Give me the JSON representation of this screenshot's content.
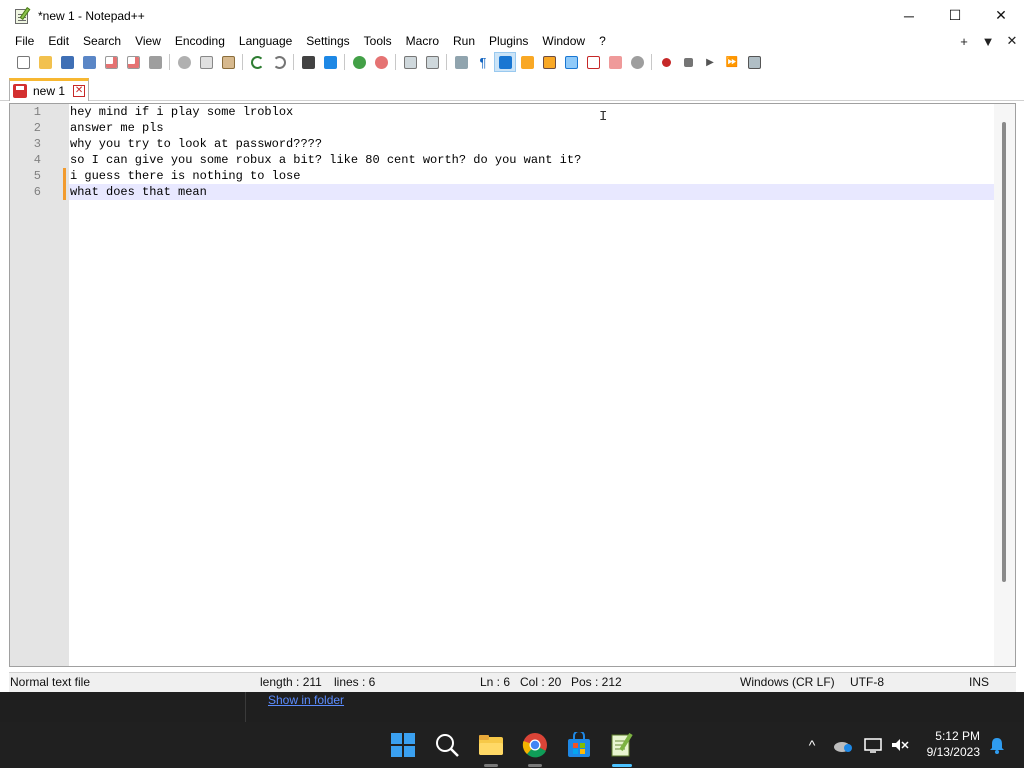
{
  "window": {
    "title": "*new 1 - Notepad++",
    "controls": {
      "minimize": "─",
      "maximize": "☐",
      "close": "✕"
    }
  },
  "menubar": {
    "items": [
      "File",
      "Edit",
      "Search",
      "View",
      "Encoding",
      "Language",
      "Settings",
      "Tools",
      "Macro",
      "Run",
      "Plugins",
      "Window",
      "?"
    ],
    "right": {
      "add": "+",
      "dropdown": "▼",
      "close": "✕"
    }
  },
  "tabs": [
    {
      "label": "new 1",
      "close": "✕"
    }
  ],
  "editor": {
    "line_numbers": [
      "1",
      "2",
      "3",
      "4",
      "5",
      "6"
    ],
    "lines": [
      "hey mind if i play some lroblox",
      "answer me pls",
      "why you try to look at password????",
      "so I can give you some robux a bit? like 80 cent worth? do you want it?",
      "i guess there is nothing to lose",
      "what does that mean"
    ],
    "current_line_index": 5
  },
  "statusbar": {
    "file_type": "Normal text file",
    "length": "length : 211",
    "lines": "lines : 6",
    "ln": "Ln : 6",
    "col": "Col : 20",
    "pos": "Pos : 212",
    "eol": "Windows (CR LF)",
    "encoding": "UTF-8",
    "mode": "INS"
  },
  "background": {
    "link_text": "Show in folder"
  },
  "taskbar": {
    "time": "5:12 PM",
    "date": "9/13/2023",
    "tray_chevron": "^"
  },
  "colors": {
    "accent_tab": "#f7b731",
    "change_marker": "#f29b2e",
    "current_line": "#e8e8ff"
  }
}
